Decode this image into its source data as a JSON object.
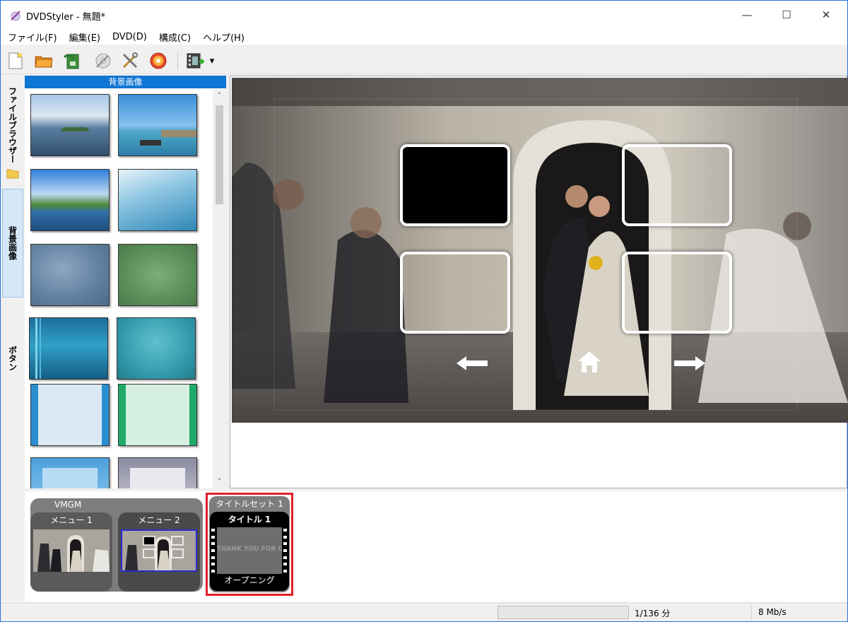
{
  "window": {
    "title": "DVDStyler - 無題*",
    "controls": {
      "minimize": "—",
      "maximize": "☐",
      "close": "✕"
    }
  },
  "menubar": {
    "items": [
      "ファイル(F)",
      "編集(E)",
      "DVD(D)",
      "構成(C)",
      "ヘルプ(H)"
    ]
  },
  "toolbar": {
    "buttons": [
      "new-icon",
      "open-folder-icon",
      "save-icon",
      "burn-disc-icon",
      "settings-tools-icon",
      "dvd-disc-icon",
      "add-video-icon"
    ],
    "dropdown": "▾"
  },
  "side_tabs": [
    {
      "label": "ファイルブラウザー",
      "active": false
    },
    {
      "label": "背景画像",
      "active": true
    },
    {
      "label": "ボタン",
      "active": false
    }
  ],
  "background_panel": {
    "header": "背景画像",
    "scroll_up": "˄",
    "scroll_down": "˅"
  },
  "titleset": {
    "vmgm_label": "VMGM",
    "menus": [
      "メニュー 1",
      "メニュー 2"
    ],
    "group_label": "タイトルセット 1",
    "title_label": "タイトル 1",
    "title_caption": "オープニング",
    "title_thumb_text": "THANK YOU FOR COMIN"
  },
  "status": {
    "size": "1/136 分",
    "bitrate": "8 Mb/s"
  },
  "colors": {
    "accent": "#0f76d3",
    "selected_border": "#e0202a"
  }
}
